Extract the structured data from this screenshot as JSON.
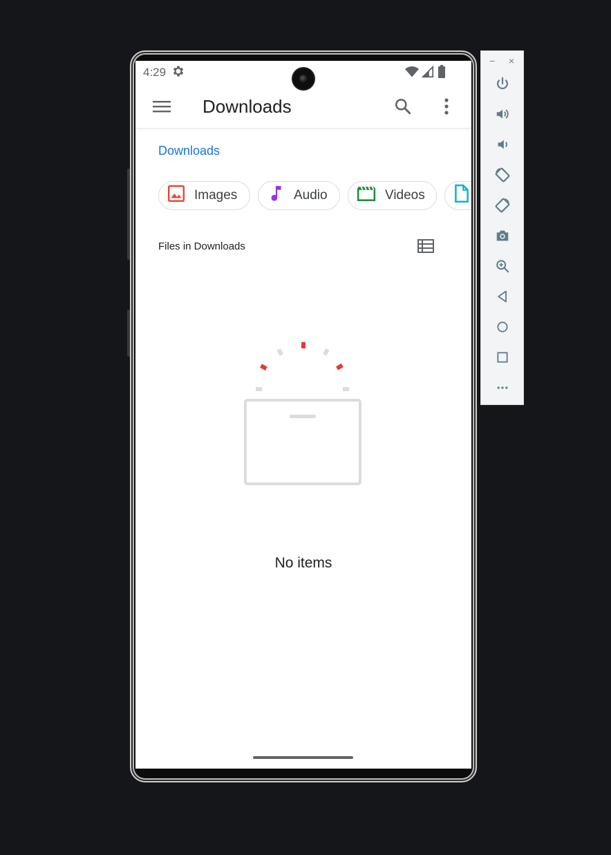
{
  "status_bar": {
    "time": "4:29",
    "icons": [
      "settings-gear-icon",
      "wifi-icon",
      "cell-signal-icon",
      "battery-icon"
    ]
  },
  "app_bar": {
    "title": "Downloads",
    "menu_icon": "hamburger-menu-icon",
    "search_icon": "search-icon",
    "more_icon": "more-vert-icon"
  },
  "breadcrumb": {
    "label": "Downloads"
  },
  "chips": [
    {
      "label": "Images",
      "icon": "image-icon",
      "color": "#ea4335"
    },
    {
      "label": "Audio",
      "icon": "music-note-icon",
      "color": "#9334e6"
    },
    {
      "label": "Videos",
      "icon": "movie-icon",
      "color": "#1e8e3e"
    },
    {
      "label": "",
      "icon": "document-icon",
      "color": "#12b5cb"
    }
  ],
  "section": {
    "title": "Files in Downloads",
    "view_icon": "list-view-icon"
  },
  "empty_state": {
    "message": "No items",
    "illustration": "empty-box-icon"
  },
  "emulator_panel": {
    "window_controls": [
      "−",
      "×"
    ],
    "buttons": [
      "power-icon",
      "volume-up-icon",
      "volume-down-icon",
      "rotate-left-icon",
      "rotate-right-icon",
      "camera-icon",
      "zoom-icon",
      "back-icon",
      "home-icon",
      "overview-icon",
      "more-horiz-icon"
    ]
  },
  "colors": {
    "accent": "#1a73e8",
    "panel_icon": "#607d8b",
    "background": "#15161a"
  }
}
